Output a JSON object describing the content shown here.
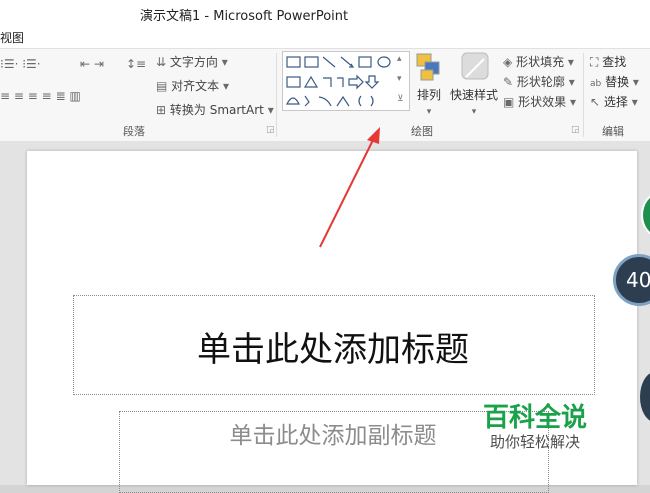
{
  "window": {
    "title": "演示文稿1 - Microsoft PowerPoint"
  },
  "menu": {
    "visible_tab": "视图"
  },
  "ribbon": {
    "paragraph": {
      "group_label": "段落",
      "text_direction": "文字方向",
      "align_text": "对齐文本",
      "convert_smartart": "转换为 SmartArt"
    },
    "drawing": {
      "group_label": "绘图",
      "arrange": "排列",
      "quick_styles": "快速样式",
      "shape_fill": "形状填充",
      "shape_outline": "形状轮廓",
      "shape_effects": "形状效果"
    },
    "editing": {
      "group_label": "编辑",
      "find": "查找",
      "replace": "替换",
      "select": "选择"
    }
  },
  "slide": {
    "title_placeholder": "单击此处添加标题",
    "subtitle_placeholder": "单击此处添加副标题"
  },
  "overlay": {
    "badge_number": "40",
    "watermark_title": "百科全说",
    "watermark_sub": "助你轻松解决"
  },
  "colors": {
    "arrow": "#e53935",
    "watermark": "#1aa14a"
  }
}
